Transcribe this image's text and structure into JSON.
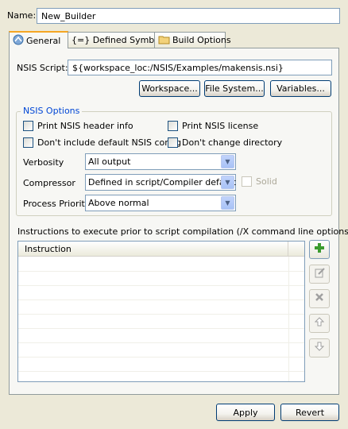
{
  "name": {
    "label": "Name:",
    "value": "New_Builder"
  },
  "tabs": [
    {
      "label": "General",
      "icon": "general-icon",
      "active": true
    },
    {
      "label": "{=} Defined Symbols",
      "icon": "",
      "active": false
    },
    {
      "label": "Build Options",
      "icon": "folder-icon",
      "active": false
    }
  ],
  "script": {
    "label": "NSIS Script:",
    "value": "${workspace_loc:/NSIS/Examples/makensis.nsi}",
    "buttons": {
      "workspace": "Workspace...",
      "file_system": "File System...",
      "variables": "Variables..."
    }
  },
  "options": {
    "title": "NSIS Options",
    "checkboxes": {
      "print_header": "Print NSIS header info",
      "print_license": "Print NSIS license",
      "no_default_config": "Don't include default NSIS config",
      "no_change_dir": "Don't change directory",
      "solid": "Solid"
    },
    "verbosity": {
      "label": "Verbosity",
      "value": "All output"
    },
    "compressor": {
      "label": "Compressor",
      "value": "Defined in script/Compiler default"
    },
    "priority": {
      "label": "Process Priority",
      "value": "Above normal"
    }
  },
  "instructions": {
    "label": "Instructions to execute prior to script compilation (/X command line options)",
    "column": "Instruction",
    "rows": []
  },
  "footer": {
    "apply": "Apply",
    "revert": "Revert"
  },
  "colors": {
    "accent": "#0046d5",
    "tab_highlight": "#f5a623",
    "background": "#ece9d8"
  }
}
